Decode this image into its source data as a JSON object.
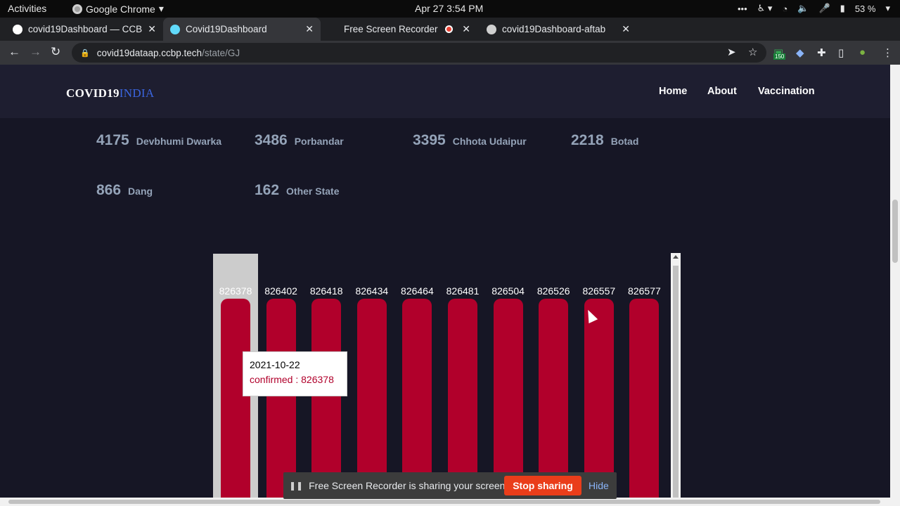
{
  "topbar": {
    "activities": "Activities",
    "app_name": "Google Chrome",
    "clock": "Apr 27  3:54 PM",
    "battery": "53 %"
  },
  "tabs": [
    {
      "title": "covid19Dashboard — CCB",
      "active": false
    },
    {
      "title": "Covid19Dashboard",
      "active": true
    },
    {
      "title": "Free Screen Recorder",
      "active": false
    },
    {
      "title": "covid19Dashboard-aftab",
      "active": false
    }
  ],
  "address": {
    "host": "covid19dataap.ccbp.tech",
    "path": "/state/GJ"
  },
  "extensions": {
    "badge": "150"
  },
  "site": {
    "logo_main": "COVID19",
    "logo_accent": "INDIA",
    "nav": [
      "Home",
      "About",
      "Vaccination"
    ]
  },
  "districts": [
    {
      "count": "4175",
      "name": "Devbhumi Dwarka"
    },
    {
      "count": "3486",
      "name": "Porbandar"
    },
    {
      "count": "3395",
      "name": "Chhota Udaipur"
    },
    {
      "count": "2218",
      "name": "Botad"
    },
    {
      "count": "866",
      "name": "Dang"
    },
    {
      "count": "162",
      "name": "Other State"
    }
  ],
  "chart_data": {
    "type": "bar",
    "series": [
      {
        "values": [
          826378,
          826402,
          826418,
          826434,
          826464,
          826481,
          826504,
          826526,
          826557,
          826577
        ]
      }
    ],
    "labels": [
      "826378",
      "826402",
      "826418",
      "826434",
      "826464",
      "826481",
      "826504",
      "826526",
      "826557",
      "826577"
    ],
    "colors": {
      "bar": "#b1002b",
      "hover": "#cccccc"
    }
  },
  "tooltip": {
    "date": "2021-10-22",
    "value_text": "confirmed : 826378"
  },
  "share_banner": {
    "message": "Free Screen Recorder is sharing your screen.",
    "stop_label": "Stop sharing",
    "hide_label": "Hide"
  }
}
